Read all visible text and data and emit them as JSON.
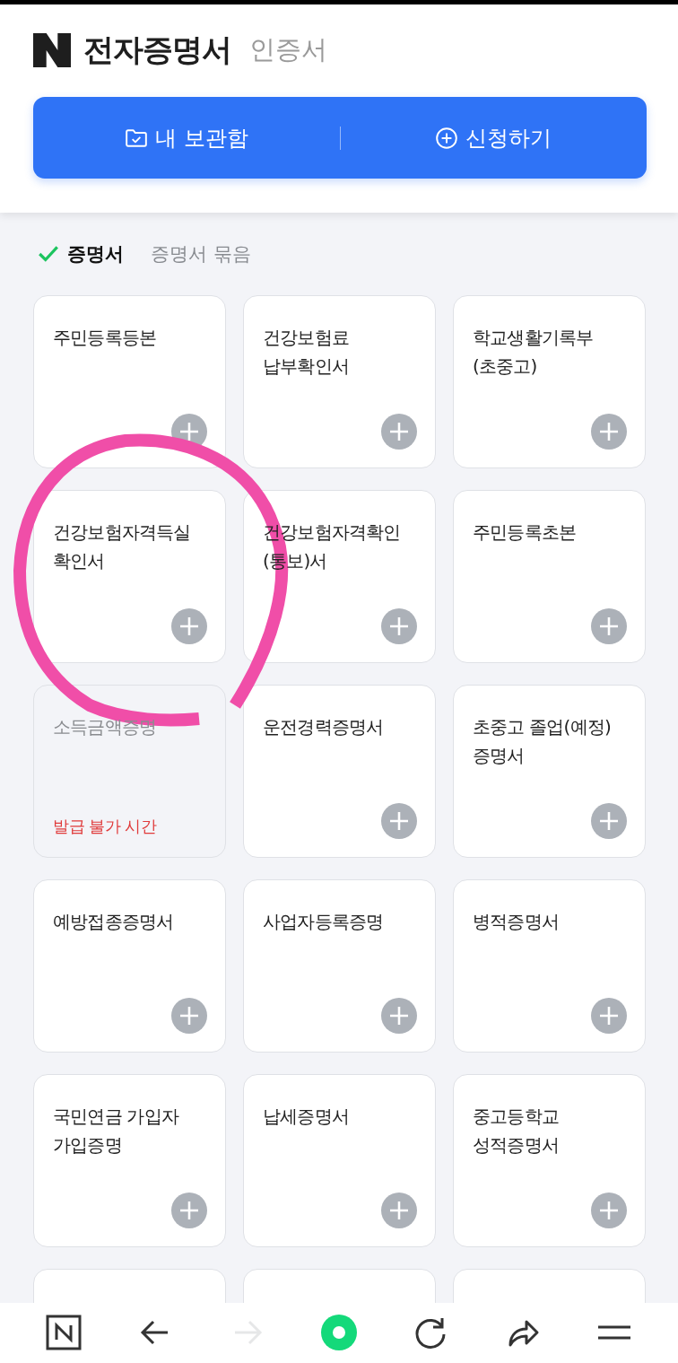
{
  "header": {
    "title": "전자증명서",
    "subtitle": "인증서"
  },
  "actions": [
    {
      "kind": "storage",
      "label": "내 보관함"
    },
    {
      "kind": "apply",
      "label": "신청하기"
    }
  ],
  "tabs": [
    {
      "label": "증명서",
      "selected": true
    },
    {
      "label": "증명서 묶음",
      "selected": false
    }
  ],
  "cards": [
    {
      "title": "주민등록등본",
      "disabled": false
    },
    {
      "title": "건강보험료\n납부확인서",
      "disabled": false
    },
    {
      "title": "학교생활기록부\n(초중고)",
      "disabled": false
    },
    {
      "title": "건강보험자격득실\n확인서",
      "disabled": false
    },
    {
      "title": "건강보험자격확인\n(통보)서",
      "disabled": false
    },
    {
      "title": "주민등록초본",
      "disabled": false
    },
    {
      "title": "소득금액증명",
      "disabled": true,
      "status": "발급 불가 시간"
    },
    {
      "title": "운전경력증명서",
      "disabled": false
    },
    {
      "title": "초중고 졸업(예정)\n증명서",
      "disabled": false
    },
    {
      "title": "예방접종증명서",
      "disabled": false
    },
    {
      "title": "사업자등록증명",
      "disabled": false
    },
    {
      "title": "병적증명서",
      "disabled": false
    },
    {
      "title": "국민연금 가입자\n가입증명",
      "disabled": false
    },
    {
      "title": "납세증명서",
      "disabled": false
    },
    {
      "title": "중고등학교\n성적증명서",
      "disabled": false
    }
  ],
  "bottom_nav": [
    {
      "kind": "home",
      "disabled": false
    },
    {
      "kind": "back",
      "disabled": false
    },
    {
      "kind": "forward",
      "disabled": true
    },
    {
      "kind": "circle",
      "disabled": false
    },
    {
      "kind": "reload",
      "disabled": false
    },
    {
      "kind": "share",
      "disabled": false
    },
    {
      "kind": "menu",
      "disabled": false
    }
  ]
}
